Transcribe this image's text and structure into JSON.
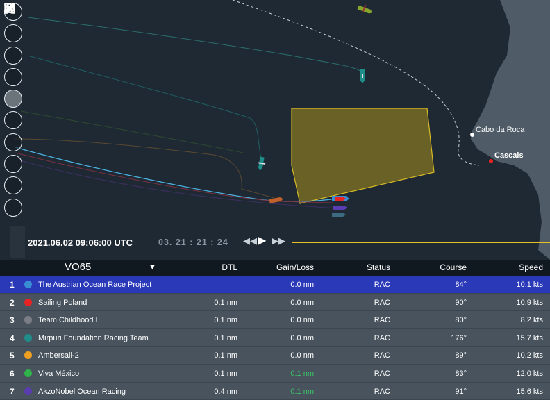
{
  "map": {
    "places": [
      {
        "name": "Cabo da Roca",
        "bold": false
      },
      {
        "name": "Cascais",
        "bold": true
      }
    ]
  },
  "toolbar": {
    "tools": [
      "fullscreen-icon",
      "map-icon",
      "layers-icon",
      "pencil-icon",
      "route-icon",
      "compass-icon",
      "wind-icon",
      "grid-icon",
      "ruler-icon",
      "chart-icon"
    ]
  },
  "playbar": {
    "datetime": "2021.06.02 09:06:00 UTC",
    "countdown": "03. 21 : 21 : 24"
  },
  "table": {
    "class_label": "VO65",
    "headers": {
      "dtl": "DTL",
      "gain": "Gain/Loss",
      "status": "Status",
      "course": "Course",
      "speed": "Speed"
    },
    "rows": [
      {
        "rank": "1",
        "color": "#3b8dd3",
        "name": "The Austrian Ocean Race Project",
        "dtl": "",
        "gain": "0.0 nm",
        "gain_green": false,
        "status": "RAC",
        "course": "84°",
        "speed": "10.1 kts"
      },
      {
        "rank": "2",
        "color": "#e82323",
        "name": "Sailing Poland",
        "dtl": "0.1 nm",
        "gain": "0.0 nm",
        "gain_green": false,
        "status": "RAC",
        "course": "90°",
        "speed": "10.9 kts"
      },
      {
        "rank": "3",
        "color": "#7a7d83",
        "name": "Team Childhood I",
        "dtl": "0.1 nm",
        "gain": "0.0 nm",
        "gain_green": false,
        "status": "RAC",
        "course": "80°",
        "speed": "8.2 kts"
      },
      {
        "rank": "4",
        "color": "#1f8d88",
        "name": "Mirpuri Foundation Racing Team",
        "dtl": "0.1 nm",
        "gain": "0.0 nm",
        "gain_green": false,
        "status": "RAC",
        "course": "176°",
        "speed": "15.7 kts"
      },
      {
        "rank": "5",
        "color": "#f0a020",
        "name": "Ambersail-2",
        "dtl": "0.1 nm",
        "gain": "0.0 nm",
        "gain_green": false,
        "status": "RAC",
        "course": "89°",
        "speed": "10.2 kts"
      },
      {
        "rank": "6",
        "color": "#2fb34a",
        "name": "Viva México",
        "dtl": "0.1 nm",
        "gain": "0.1 nm",
        "gain_green": true,
        "status": "RAC",
        "course": "83°",
        "speed": "12.0 kts"
      },
      {
        "rank": "7",
        "color": "#5a3db0",
        "name": "AkzoNobel Ocean Racing",
        "dtl": "0.4 nm",
        "gain": "0.1 nm",
        "gain_green": true,
        "status": "RAC",
        "course": "91°",
        "speed": "15.6 kts"
      }
    ]
  }
}
